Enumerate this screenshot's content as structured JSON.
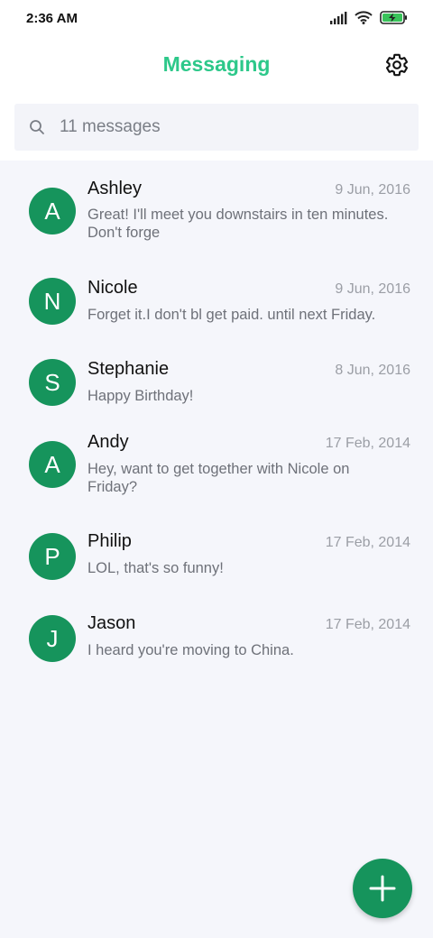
{
  "status_bar": {
    "time": "2:36 AM",
    "icons": [
      "signal-icon",
      "wifi-icon",
      "battery-charging-icon"
    ]
  },
  "header": {
    "title": "Messaging",
    "settings_icon": "gear-icon"
  },
  "search": {
    "placeholder": "11 messages",
    "icon": "search-icon"
  },
  "messages": [
    {
      "initial": "A",
      "sender": "Ashley",
      "date": "9 Jun, 2016",
      "preview": "Great! I'll meet you downstairs in ten minutes. Don't forge"
    },
    {
      "initial": "N",
      "sender": "Nicole",
      "date": "9 Jun, 2016",
      "preview": "Forget it.I don't bl get paid. until next Friday."
    },
    {
      "initial": "S",
      "sender": "Stephanie",
      "date": "8 Jun, 2016",
      "preview": "Happy Birthday!"
    },
    {
      "initial": "A",
      "sender": "Andy",
      "date": "17 Feb, 2014",
      "preview": "Hey, want to get together with Nicole on Friday?"
    },
    {
      "initial": "P",
      "sender": "Philip",
      "date": "17 Feb, 2014",
      "preview": "LOL, that's so funny!"
    },
    {
      "initial": "J",
      "sender": "Jason",
      "date": "17 Feb, 2014",
      "preview": "I heard you're moving to China."
    }
  ],
  "fab": {
    "icon": "plus-icon"
  },
  "colors": {
    "accent": "#2dc88a",
    "avatar": "#16945c",
    "list_background": "#f5f6fb"
  }
}
